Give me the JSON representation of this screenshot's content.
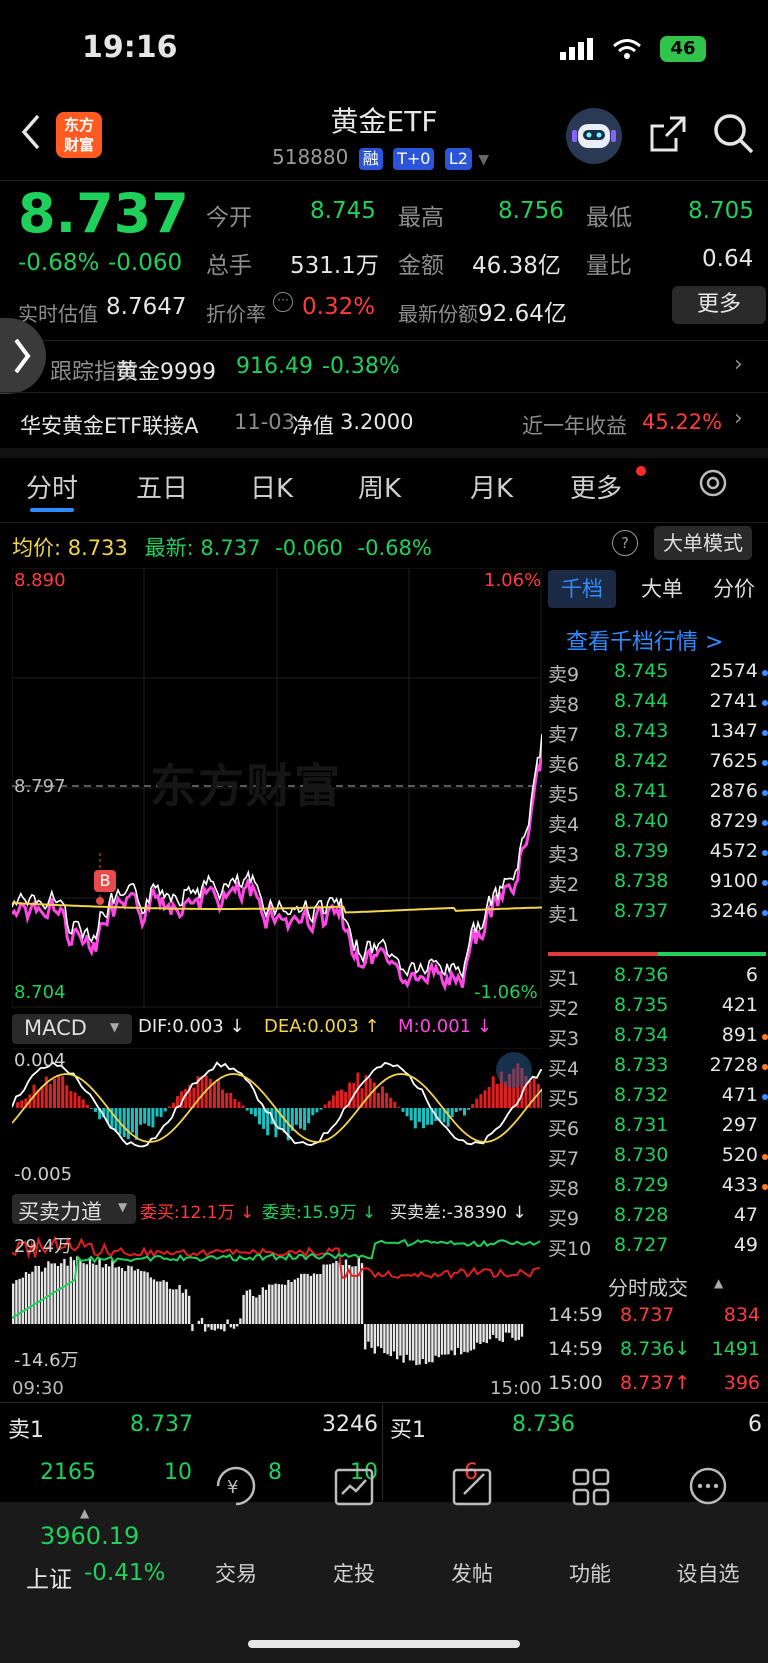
{
  "status_bar": {
    "time": "19:16",
    "network": "46"
  },
  "header": {
    "back_icon": "chevron-left-icon",
    "logo_text": "东方\n财富",
    "title": "黄金ETF",
    "code": "518880",
    "badges": [
      "融",
      "T+0",
      "L2"
    ],
    "robot_icon": "robot-avatar-icon",
    "share_icon": "share-icon",
    "search_icon": "search-icon"
  },
  "quote": {
    "price": "8.737",
    "change_pct": "-0.68%",
    "change": "-0.060",
    "open_label": "今开",
    "open": "8.745",
    "high_label": "最高",
    "high": "8.756",
    "low_label": "最低",
    "low": "8.705",
    "volume_label": "总手",
    "volume": "531.1万",
    "amount_label": "金额",
    "amount": "46.38亿",
    "ratio_label": "量比",
    "ratio": "0.64",
    "est_label": "实时估值",
    "est": "8.7647",
    "premium_label": "折价率",
    "premium": "0.32%",
    "shares_label": "最新份额",
    "shares": "92.64亿",
    "more_label": "更多"
  },
  "index_row": {
    "label": "跟踪指数",
    "name": "黄金9999",
    "value": "916.49",
    "change": "-0.38%"
  },
  "fund_row": {
    "name": "华安黄金ETF联接A",
    "date": "11-03",
    "nav_label": "净值",
    "nav": "3.2000",
    "yield_label": "近一年收益",
    "yield": "45.22%"
  },
  "tabs": [
    "分时",
    "五日",
    "日K",
    "周K",
    "月K",
    "更多"
  ],
  "avg_row": {
    "avg_label": "均价:",
    "avg": "8.733",
    "last_label": "最新:",
    "last": "8.737",
    "chg": "-0.060",
    "pct": "-0.68%",
    "mode_label": "大单模式"
  },
  "chart_labels": {
    "top": "8.890",
    "top_pct": "1.06%",
    "mid": "8.797",
    "bottom": "8.704",
    "bottom_pct": "-1.06%",
    "watermark": "东方财富",
    "b_mark": "B",
    "start_time": "09:30",
    "end_time": "15:00"
  },
  "macd": {
    "name": "MACD",
    "dif": "DIF:0.003 ↓",
    "dea": "DEA:0.003 ↑",
    "m": "M:0.001 ↓",
    "top": "0.004",
    "bottom": "-0.005"
  },
  "power": {
    "name": "买卖力道",
    "buy": "委买:12.1万 ↓",
    "sell": "委卖:15.9万 ↓",
    "diff": "买卖差:-38390 ↓",
    "top": "29.4万",
    "bottom": "-14.6万"
  },
  "book_tabs": [
    "千档",
    "大单",
    "分价"
  ],
  "book_link": "查看千档行情 >",
  "asks": [
    {
      "label": "卖9",
      "price": "8.745",
      "vol": "2574"
    },
    {
      "label": "卖8",
      "price": "8.744",
      "vol": "2741"
    },
    {
      "label": "卖7",
      "price": "8.743",
      "vol": "1347"
    },
    {
      "label": "卖6",
      "price": "8.742",
      "vol": "7625"
    },
    {
      "label": "卖5",
      "price": "8.741",
      "vol": "2876"
    },
    {
      "label": "卖4",
      "price": "8.740",
      "vol": "8729"
    },
    {
      "label": "卖3",
      "price": "8.739",
      "vol": "4572"
    },
    {
      "label": "卖2",
      "price": "8.738",
      "vol": "9100"
    },
    {
      "label": "卖1",
      "price": "8.737",
      "vol": "3246"
    }
  ],
  "bids": [
    {
      "label": "买1",
      "price": "8.736",
      "vol": "6"
    },
    {
      "label": "买2",
      "price": "8.735",
      "vol": "421"
    },
    {
      "label": "买3",
      "price": "8.734",
      "vol": "891"
    },
    {
      "label": "买4",
      "price": "8.733",
      "vol": "2728"
    },
    {
      "label": "买5",
      "price": "8.732",
      "vol": "471"
    },
    {
      "label": "买6",
      "price": "8.731",
      "vol": "297"
    },
    {
      "label": "买7",
      "price": "8.730",
      "vol": "520"
    },
    {
      "label": "买8",
      "price": "8.729",
      "vol": "433"
    },
    {
      "label": "买9",
      "price": "8.728",
      "vol": "47"
    },
    {
      "label": "买10",
      "price": "8.727",
      "vol": "49"
    }
  ],
  "trades_title": "分时成交",
  "trades": [
    {
      "time": "14:59",
      "price": "8.737",
      "vol": "834"
    },
    {
      "time": "14:59",
      "price": "8.736↓",
      "vol": "1491"
    },
    {
      "time": "15:00",
      "price": "8.737↑",
      "vol": "396"
    }
  ],
  "bottom_quote": {
    "sell_label": "卖1",
    "sell_price": "8.737",
    "sell_vol": "3246",
    "buy_label": "买1",
    "buy_price": "8.736",
    "buy_vol": "6",
    "sell_queue": [
      "2165",
      "10",
      "8",
      "10"
    ],
    "buy_queue": [
      "6"
    ]
  },
  "bottom_nav": {
    "index_value": "3960.19",
    "index_name": "上证",
    "index_change": "-0.41%",
    "items": [
      "交易",
      "定投",
      "发帖",
      "功能",
      "设自选"
    ]
  },
  "colors": {
    "up": "#ff3b3b",
    "down": "#1fd15a",
    "accent": "#2f8cff",
    "avg_line": "#f3d44b",
    "price_line": "#ffffff",
    "shadow_line": "#ff47e6"
  }
}
